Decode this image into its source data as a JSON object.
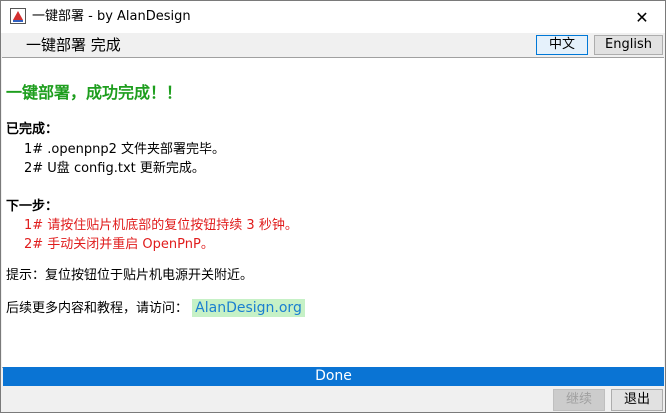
{
  "window": {
    "title": "一键部署 - by AlanDesign",
    "close_glyph": "✕"
  },
  "header": {
    "title": "一键部署 完成",
    "lang_cn": "中文",
    "lang_en": "English"
  },
  "content": {
    "heading": "一键部署，成功完成！！",
    "done_title": "已完成：",
    "done_items": [
      "1# .openpnp2 文件夹部署完毕。",
      "2# U盘 config.txt 更新完成。"
    ],
    "next_title": "下一步：",
    "next_items": [
      "1# 请按住贴片机底部的复位按钮持续 3 秒钟。",
      "2# 手动关闭并重启 OpenPnP。"
    ],
    "hint": "提示：复位按钮位于贴片机电源开关附近。",
    "visit_text": "后续更多内容和教程，请访问：",
    "link_text": "AlanDesign.org"
  },
  "progress": {
    "label": "Done",
    "value_percent": 100
  },
  "buttons": {
    "continue": "继续",
    "exit": "退出"
  },
  "colors": {
    "heading": "#1e9e1e",
    "next_step": "#e01c1c",
    "progress": "#0a74d4",
    "link_bg": "#c6f1c6"
  }
}
